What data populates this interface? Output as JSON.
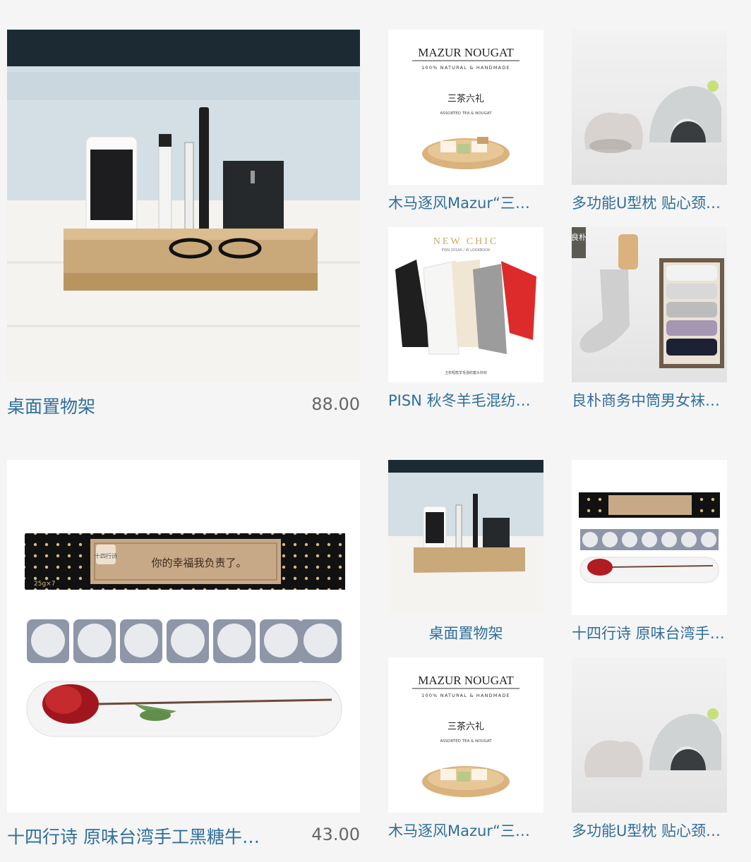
{
  "products": [
    {
      "id": "p1",
      "title": "桌面置物架",
      "price": "88.00"
    },
    {
      "id": "p2",
      "title": "木马逐风Mazur“三茶六礼”牛轧糖礼盒"
    },
    {
      "id": "p3",
      "title": "多功能U型枕 贴心颈部护理"
    },
    {
      "id": "p4",
      "title": "PISN 秋冬羊毛混纺针织开衫"
    },
    {
      "id": "p5",
      "title": "良朴商务中筒男女袜礼盒"
    },
    {
      "id": "p6",
      "title": "十四行诗 原味台湾手工黑糖牛轧糖",
      "price": "43.00"
    },
    {
      "id": "p7",
      "title": "桌面置物架"
    },
    {
      "id": "p8",
      "title": "十四行诗 原味台湾手工黑糖"
    },
    {
      "id": "p9",
      "title": "木马逐风Mazur“三茶六礼”牛轧糖礼盒"
    },
    {
      "id": "p10",
      "title": "多功能U型枕 贴心颈部护理"
    }
  ],
  "packaging": {
    "mazur_brand": "MAZUR NOUGAT",
    "mazur_tagline": "100% NATURAL & HANDMADE",
    "mazur_cn": "三茶六礼",
    "mazur_sub": "ASSORTED TEA & NOUGAT",
    "pisn_headline": "NEW CHIC",
    "pisn_sub": "PISN 2016A / W LOOKBOOK",
    "pisn_caption": "卫衣短款羊毛混纺套头针织",
    "sonnet_slogan": "你的幸福我负责了。",
    "sonnet_count": "25g×7",
    "sonnet_logo": "十四行诗",
    "sock_brand": "良朴"
  },
  "colors": {
    "title": "#2f6f99",
    "price": "#666666",
    "background": "#f5f5f5"
  }
}
